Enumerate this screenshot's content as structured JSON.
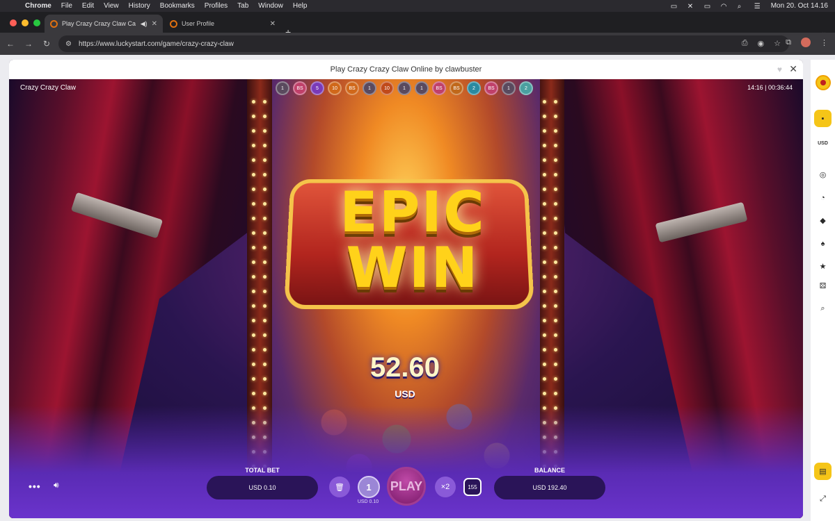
{
  "menubar": {
    "app": "Chrome",
    "items": [
      "File",
      "Edit",
      "View",
      "History",
      "Bookmarks",
      "Profiles",
      "Tab",
      "Window",
      "Help"
    ],
    "datetime": "Mon 20. Oct  14.16"
  },
  "browser": {
    "tabs": [
      {
        "title": "Play Crazy Crazy Claw Ca",
        "active": true
      },
      {
        "title": "User Profile",
        "active": false
      }
    ],
    "url": "https://www.luckystart.com/game/crazy-crazy-claw"
  },
  "modal": {
    "title": "Play Crazy Crazy Claw Online by clawbuster"
  },
  "game": {
    "name": "Crazy Crazy Claw",
    "clock": "14:16  |  00:36:44",
    "history": [
      {
        "label": "1",
        "color": "#5a4a5e"
      },
      {
        "label": "BS",
        "color": "#c0406a"
      },
      {
        "label": "5",
        "color": "#7a3ab8"
      },
      {
        "label": "10",
        "color": "#d0681a"
      },
      {
        "label": "BS",
        "color": "#d0681a"
      },
      {
        "label": "1",
        "color": "#5a4a5e"
      },
      {
        "label": "10",
        "color": "#c04a1a"
      },
      {
        "label": "1",
        "color": "#5a4a5e"
      },
      {
        "label": "1",
        "color": "#5a4a5e"
      },
      {
        "label": "BS",
        "color": "#c0406a"
      },
      {
        "label": "BS",
        "color": "#c0681a"
      },
      {
        "label": "2",
        "color": "#2a8aa0"
      },
      {
        "label": "BS",
        "color": "#c0406a"
      },
      {
        "label": "1",
        "color": "#5a4a5e"
      },
      {
        "label": "2",
        "color": "#4aa0a0"
      }
    ],
    "banner_line1": "EPIC",
    "banner_line2": "WIN",
    "win_amount": "52.60",
    "win_currency": "USD",
    "total_bet_label": "TOTAL BET",
    "total_bet_value": "USD 0.10",
    "stake_chip": "1",
    "stake_sub": "USD 0.10",
    "play_label": "PLAY",
    "multiplier_label": "×2",
    "autoplay_count": "155",
    "balance_label": "BALANCE",
    "balance_value": "USD 192.40"
  },
  "sidebar": {
    "currency": "USD"
  }
}
